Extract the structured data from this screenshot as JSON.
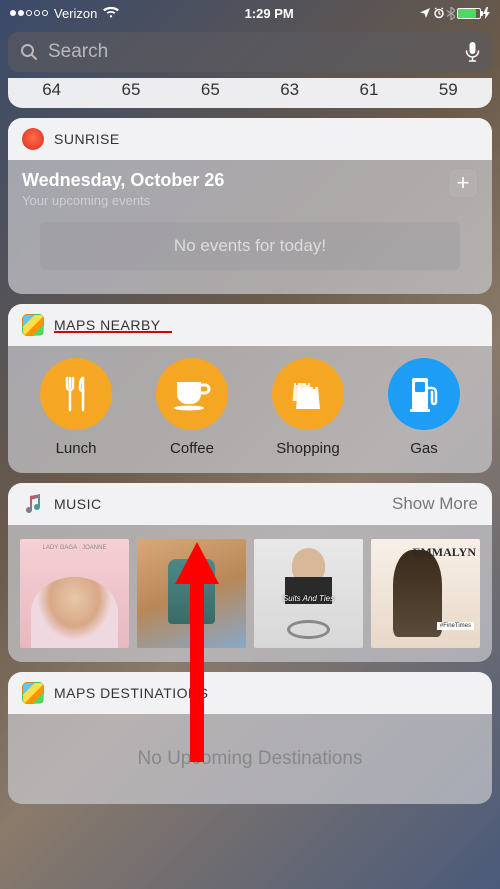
{
  "status": {
    "carrier": "Verizon",
    "time": "1:29 PM"
  },
  "search": {
    "placeholder": "Search"
  },
  "weather": {
    "temps": [
      "64",
      "65",
      "65",
      "63",
      "61",
      "59"
    ]
  },
  "sunrise": {
    "title": "SUNRISE",
    "date": "Wednesday, October 26",
    "sub": "Your upcoming events",
    "empty": "No events for today!"
  },
  "maps_nearby": {
    "title": "MAPS NEARBY",
    "items": [
      {
        "label": "Lunch",
        "icon": "fork-knife",
        "color": "#f5a623"
      },
      {
        "label": "Coffee",
        "icon": "cup",
        "color": "#f5a623"
      },
      {
        "label": "Shopping",
        "icon": "bag",
        "color": "#f5a623"
      },
      {
        "label": "Gas",
        "icon": "pump",
        "color": "#1e9df7"
      }
    ]
  },
  "music": {
    "title": "MUSIC",
    "show_more": "Show More",
    "albums": [
      {
        "caption": "LADY GAGA · JOANNE"
      },
      {
        "caption": ""
      },
      {
        "caption": "Suits And Ties"
      },
      {
        "caption": "EMMALYN"
      }
    ]
  },
  "maps_dest": {
    "title": "MAPS DESTINATIONS",
    "empty": "No Upcoming Destinations"
  }
}
